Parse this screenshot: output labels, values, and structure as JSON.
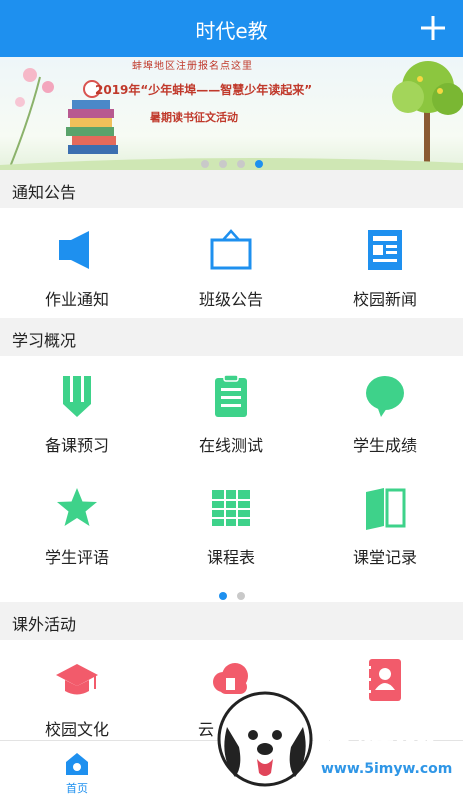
{
  "header": {
    "title": "时代e教"
  },
  "banner": {
    "top_text": "蚌埠地区注册报名点这里",
    "main_text": "2019年“少年蚌埠——智慧少年读起来”",
    "sub_text": "暑期读书征文活动",
    "slide_count": 4,
    "active_slide": 4
  },
  "sections": {
    "notice": {
      "title": "通知公告",
      "items": [
        {
          "label": "作业通知",
          "icon": "speaker-icon"
        },
        {
          "label": "班级公告",
          "icon": "board-icon"
        },
        {
          "label": "校园新闻",
          "icon": "newspaper-icon"
        }
      ]
    },
    "study": {
      "title": "学习概况",
      "items": [
        {
          "label": "备课预习",
          "icon": "pencil-icon"
        },
        {
          "label": "在线测试",
          "icon": "clipboard-icon"
        },
        {
          "label": "学生成绩",
          "icon": "chat-bubble-icon"
        },
        {
          "label": "学生评语",
          "icon": "star-icon"
        },
        {
          "label": "课程表",
          "icon": "grid-icon"
        },
        {
          "label": "课堂记录",
          "icon": "book-icon"
        }
      ]
    },
    "activity": {
      "title": "课外活动",
      "items": [
        {
          "label": "校园文化",
          "icon": "graduation-cap-icon"
        },
        {
          "label": "云",
          "icon": "cloud-icon"
        },
        {
          "label": "",
          "icon": "contact-book-icon"
        }
      ]
    }
  },
  "pager": {
    "count": 2,
    "active": 1
  },
  "tabbar": {
    "home_label": "首页"
  },
  "watermark": {
    "name": "萌游网",
    "url": "www.5imyw.com"
  },
  "colors": {
    "primary": "#1e90ef",
    "green": "#3ed28a",
    "red": "#f25b6b"
  }
}
